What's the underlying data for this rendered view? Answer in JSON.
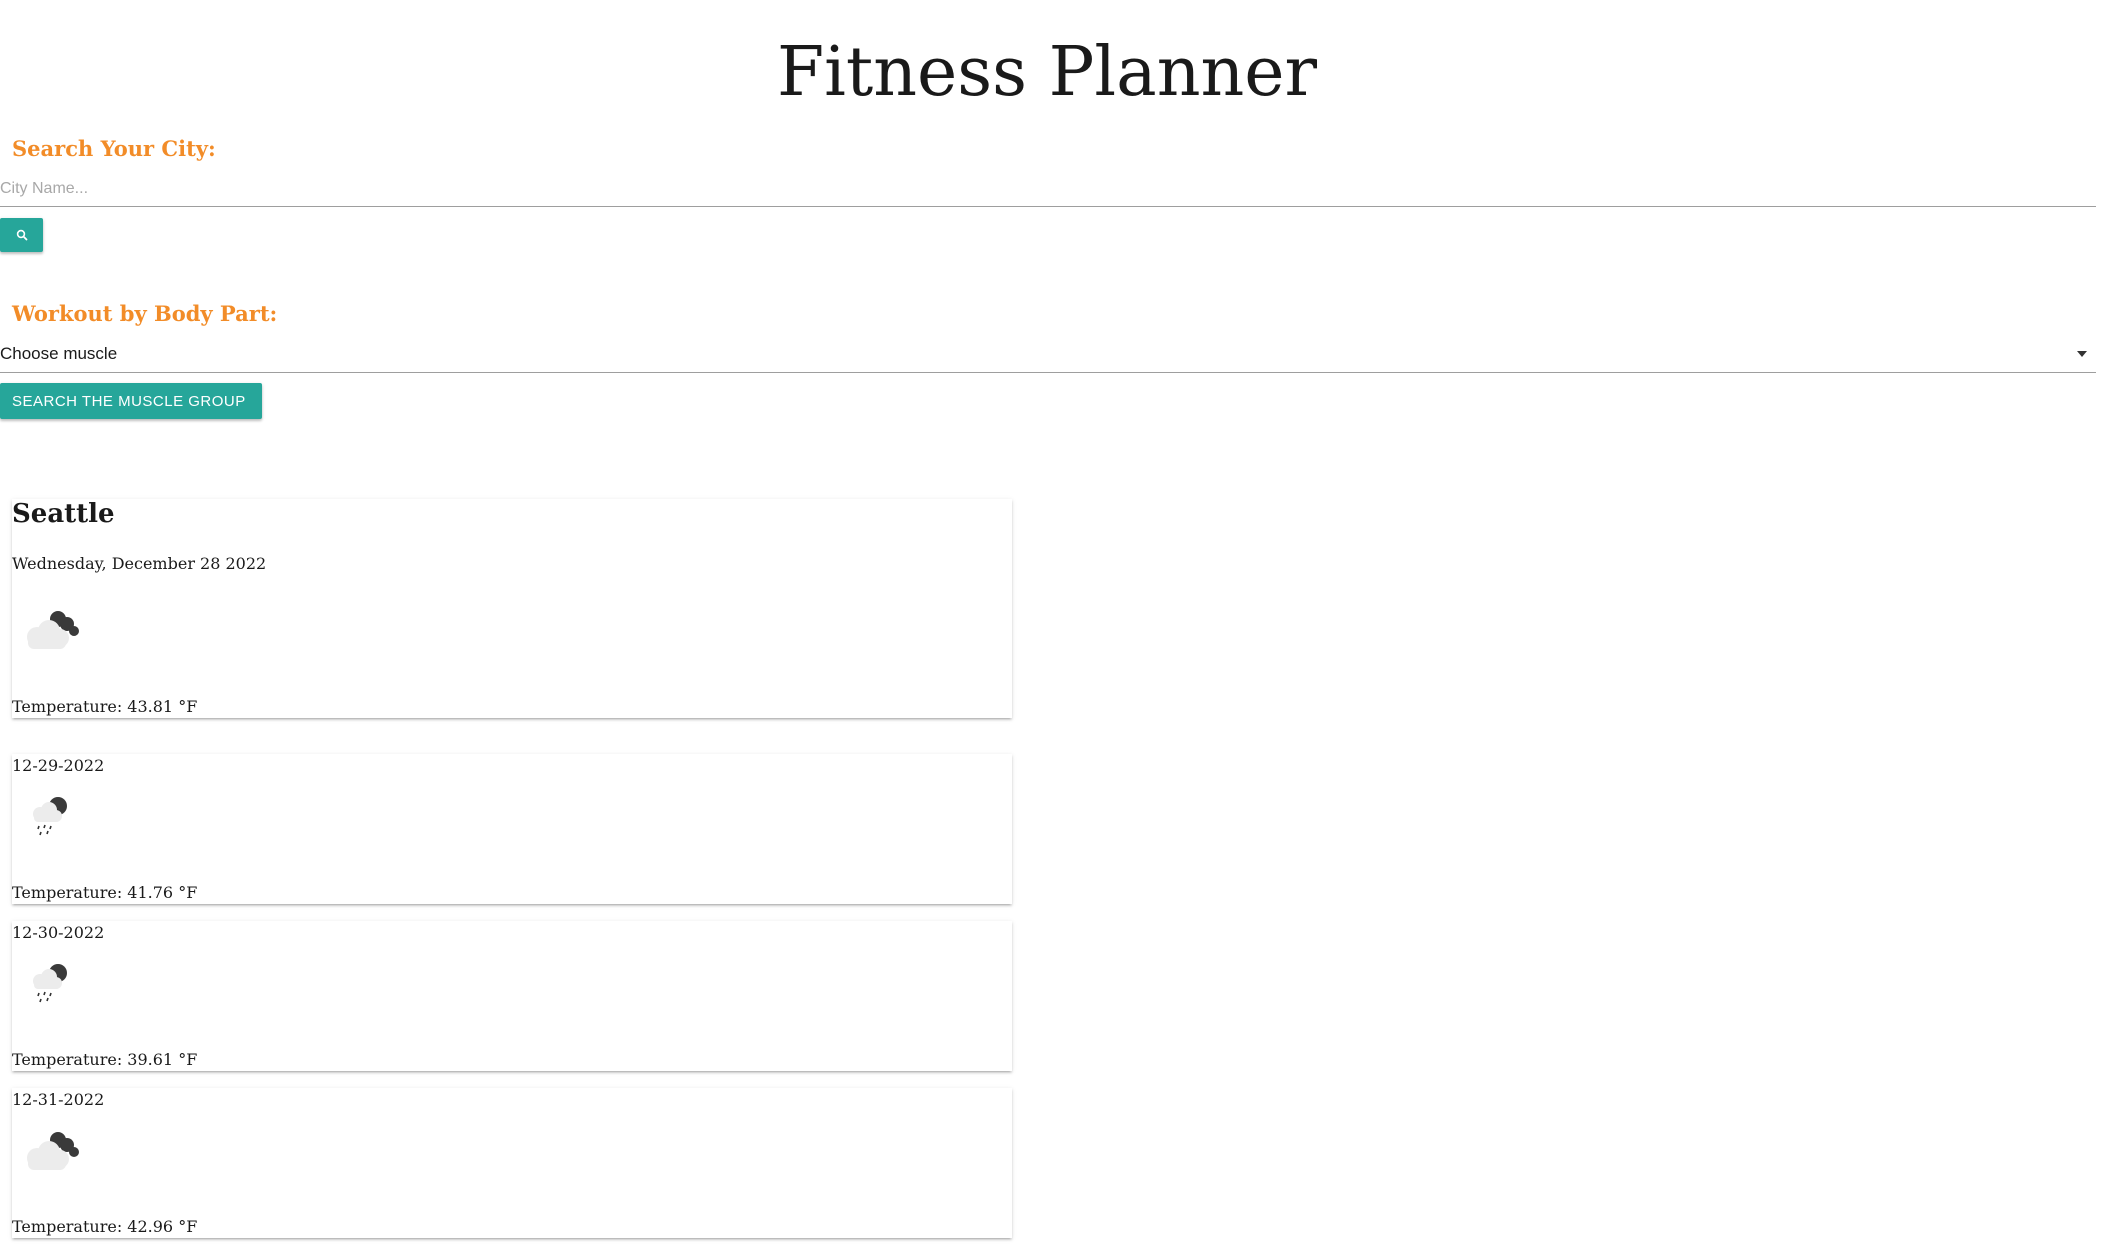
{
  "header": {
    "title": "Fitness Planner"
  },
  "city_search": {
    "label": "Search Your City:",
    "placeholder": "City Name...",
    "value": "",
    "button_icon": "search-icon"
  },
  "workout": {
    "label": "Workout by Body Part:",
    "selected_option": "Choose muscle",
    "button_label": "Search the muscle group"
  },
  "colors": {
    "accent_orange": "#f28c28",
    "button_teal": "#26a69a"
  },
  "weather": {
    "city": "Seattle",
    "current": {
      "date": "Wednesday, December 28 2022",
      "icon": "partly-cloudy-icon",
      "temperature": "Temperature: 43.81 °F"
    },
    "forecast": [
      {
        "date": "12-29-2022",
        "icon": "rain-cloud-icon",
        "temperature": "Temperature: 41.76 °F"
      },
      {
        "date": "12-30-2022",
        "icon": "rain-cloud-icon",
        "temperature": "Temperature: 39.61 °F"
      },
      {
        "date": "12-31-2022",
        "icon": "partly-cloudy-icon",
        "temperature": "Temperature: 42.96 °F"
      }
    ]
  }
}
